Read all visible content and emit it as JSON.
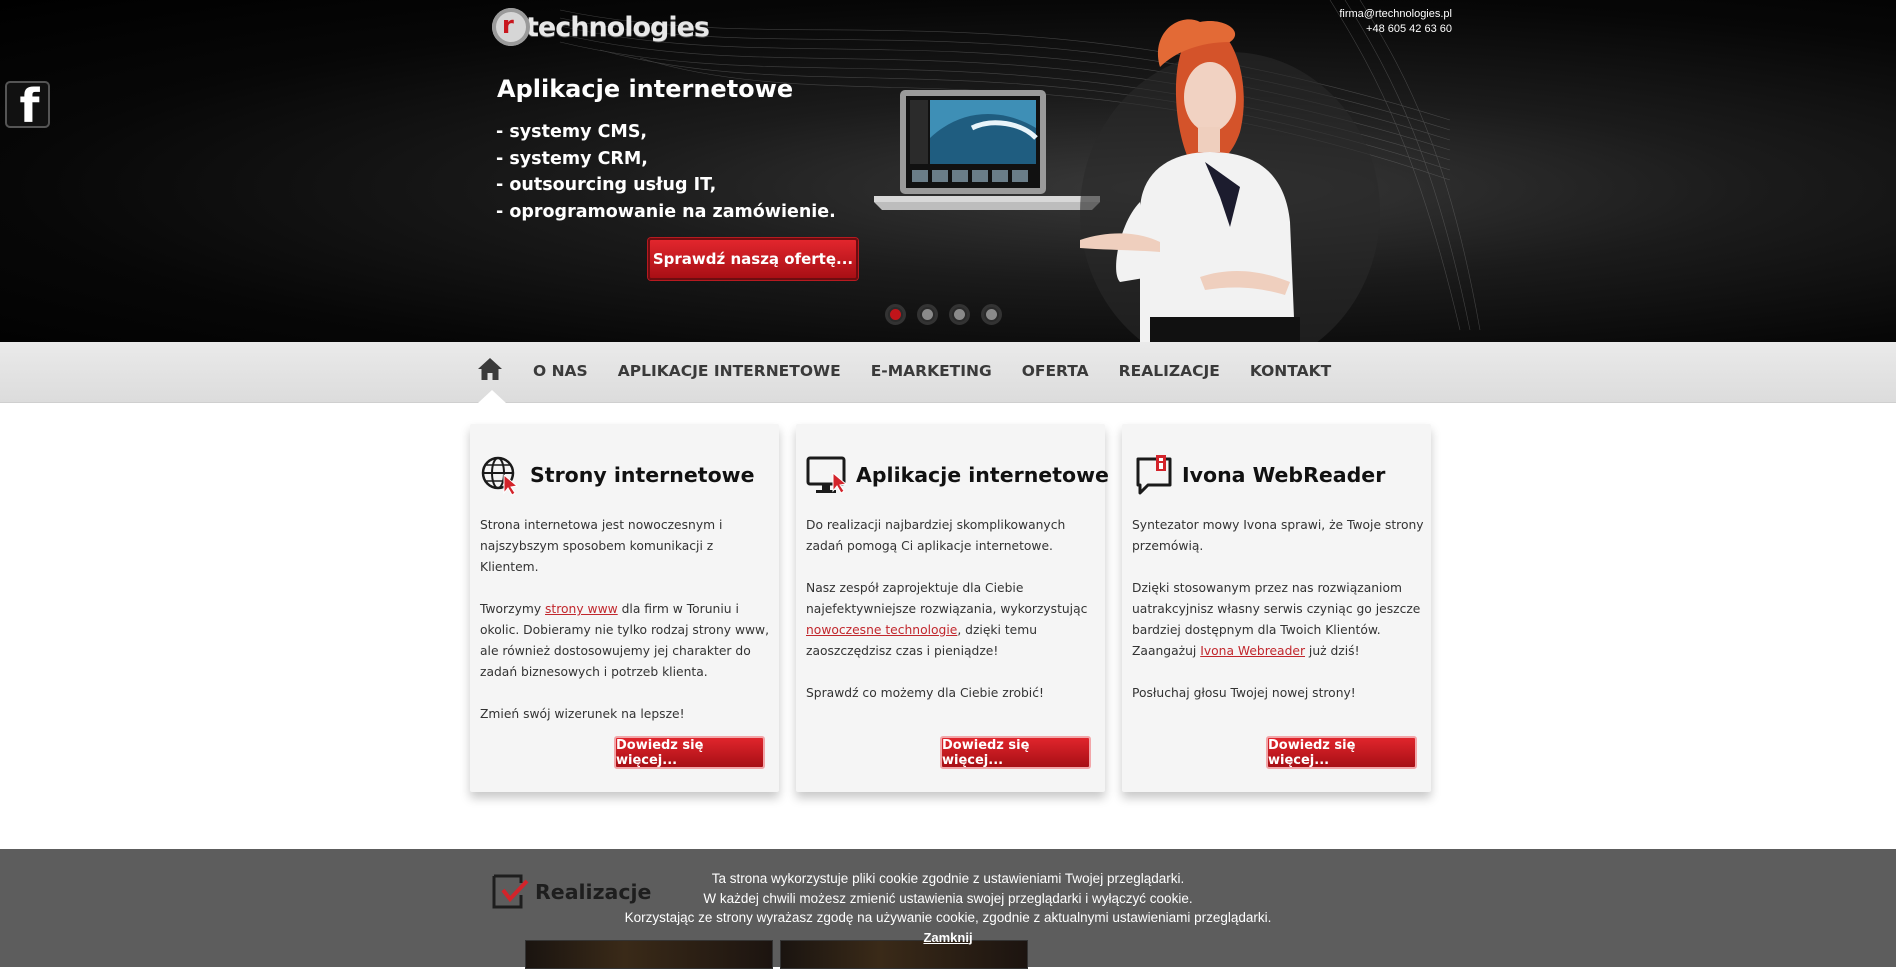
{
  "header": {
    "logo_text": "technologies",
    "logo_letter": "r",
    "email": "firma@rtechnologies.pl",
    "phone": "+48 605 42 63 60"
  },
  "slider": {
    "title": "Aplikacje internetowe",
    "items": [
      "- systemy CMS,",
      "- systemy CRM,",
      "- outsourcing usług IT,",
      "- oprogramowanie na zamówienie."
    ],
    "button": "Sprawdź naszą ofertę...",
    "slides": 4,
    "active_slide": 1
  },
  "social": {
    "icon": "facebook-icon",
    "letter": "f"
  },
  "nav": {
    "home_icon": "home-icon",
    "items": [
      "O NAS",
      "APLIKACJE INTERNETOWE",
      "E-MARKETING",
      "OFERTA",
      "REALIZACJE",
      "KONTAKT"
    ]
  },
  "cards": [
    {
      "icon": "globe-cursor-icon",
      "title": "Strony internetowe",
      "p1": "Strona internetowa jest nowoczesnym i najszybszym sposobem komunikacji z Klientem.",
      "p2_before": "Tworzymy ",
      "p2_link": "strony www",
      "p2_after": " dla firm w Toruniu i okolic. Dobieramy nie tylko rodzaj strony www, ale również dostosowujemy jej charakter do zadań biznesowych i potrzeb klienta.",
      "p3": "Zmień swój wizerunek na lepsze!",
      "button": "Dowiedz się więcej..."
    },
    {
      "icon": "monitor-cursor-icon",
      "title": "Aplikacje internetowe",
      "p1": "Do realizacji najbardziej skomplikowanych zadań pomogą Ci aplikacje internetowe.",
      "p2_before": "Nasz zespół zaprojektuje dla Ciebie najefektywniejsze rozwiązania, wykorzystując ",
      "p2_link": "nowoczesne technologie",
      "p2_after": ", dzięki temu zaoszczędzisz czas i pieniądze!",
      "p3": "Sprawdź co możemy dla Ciebie zrobić!",
      "button": "Dowiedz się więcej..."
    },
    {
      "icon": "speech-bubble-icon",
      "title": "Ivona WebReader",
      "p1": "Syntezator mowy Ivona sprawi, że Twoje strony przemówią.",
      "p2_before": "Dzięki stosowanym przez nas rozwiązaniom uatrakcyjnisz własny serwis czyniąc go jeszcze bardziej dostępnym dla Twoich Klientów. Zaangażuj ",
      "p2_link": "Ivona Webreader",
      "p2_after": " już dziś!",
      "p3": "Posłuchaj głosu Twojej nowej strony!",
      "button": "Dowiedz się więcej..."
    }
  ],
  "realizacje": {
    "title": "Realizacje",
    "icon": "checkbox-icon"
  },
  "cookie": {
    "line1": "Ta strona wykorzystuje pliki cookie zgodnie z ustawieniami Twojej przeglądarki.",
    "line2": "W każdej chwili możesz zmienić ustawienia swojej przeglądarki i wyłączyć cookie.",
    "line3": "Korzystając ze strony wyrażasz zgodę na używanie cookie, zgodnie z aktualnymi ustawieniami przeglądarki.",
    "close": "Zamknij"
  },
  "colors": {
    "accent": "#c1141a",
    "nav_bg": "#e3e3e3",
    "footer_bg": "#5d5d5d"
  }
}
